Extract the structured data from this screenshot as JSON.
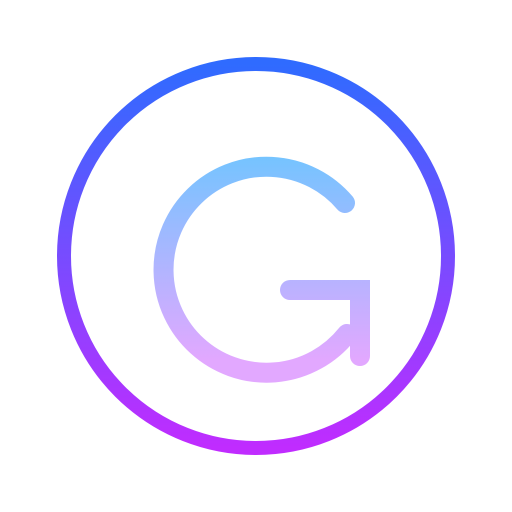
{
  "icon": {
    "name": "refresh-g-circle-icon",
    "outer_gradient": {
      "top": "#2f6bff",
      "bottom": "#c02cff"
    },
    "inner_gradient": {
      "top": "#6cc6ff",
      "bottom": "#e2a8ff"
    }
  }
}
